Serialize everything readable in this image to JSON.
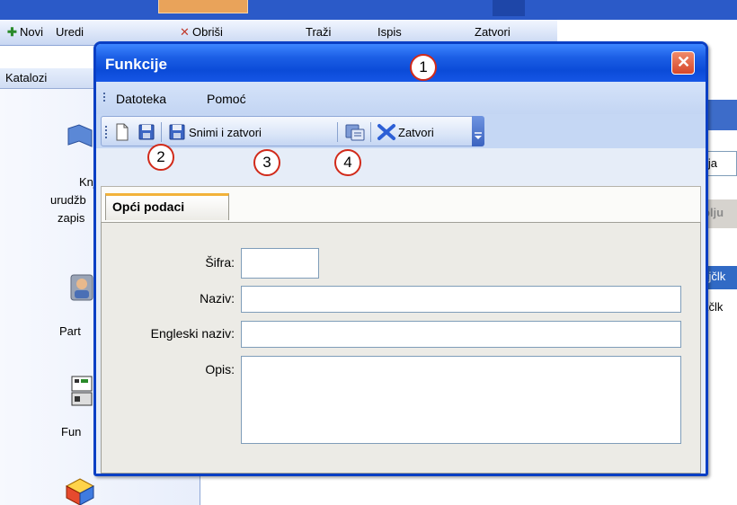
{
  "background": {
    "toolbar": [
      "Novi",
      "Uredi",
      "Obriši",
      "Traži",
      "Ispis",
      "Zatvori"
    ],
    "catalogs_header": "Katalozi",
    "catalog_labels": [
      "Knj",
      "urudžb",
      "zapis",
      "Part",
      "Fun"
    ],
    "right_fragments": [
      "ija",
      "olju",
      "kjčlk",
      "kčlk"
    ]
  },
  "dialog": {
    "title": "Funkcije",
    "close_glyph": "✕",
    "menu": [
      "Datoteka",
      "Pomoć"
    ],
    "toolbar": {
      "save_close_label": "Snimi i zatvori",
      "close_label": "Zatvori"
    },
    "tab_label": "Opći podaci",
    "fields": {
      "code_label": "Šifra:",
      "code_value": "",
      "name_label": "Naziv:",
      "name_value": "",
      "english_name_label": "Engleski naziv:",
      "english_name_value": "",
      "description_label": "Opis:",
      "description_value": ""
    }
  },
  "markers": [
    "1",
    "2",
    "3",
    "4"
  ],
  "colors": {
    "title_bar": "#0b4bd8",
    "close_button": "#d6472a",
    "marker_border": "#d12a1a",
    "tab_accent": "#f2b23a"
  }
}
